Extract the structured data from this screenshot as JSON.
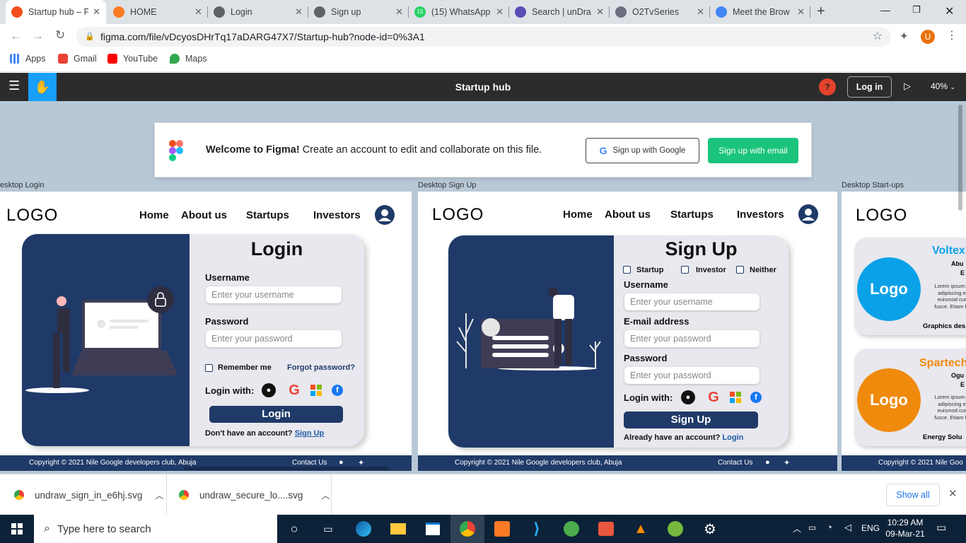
{
  "browser": {
    "tabs": [
      {
        "title": "Startup hub – F",
        "active": true,
        "color": "#f24e1e"
      },
      {
        "title": "HOME",
        "active": false,
        "color": "#fb7a24"
      },
      {
        "title": "Login",
        "active": false,
        "color": "#5f6368"
      },
      {
        "title": "Sign up",
        "active": false,
        "color": "#5f6368"
      },
      {
        "title": "(15) WhatsApp",
        "active": false,
        "color": "#25d366"
      },
      {
        "title": "Search | unDra",
        "active": false,
        "color": "#5a4bb5"
      },
      {
        "title": "O2TvSeries",
        "active": false,
        "color": "#6c6f7d"
      },
      {
        "title": "Meet the Brow",
        "active": false,
        "color": "#4285f4"
      }
    ],
    "whatsapp_badge": "15",
    "url": "figma.com/file/vDcyosDHrTq17aDARG47X7/Startup-hub?node-id=0%3A1",
    "profile_initial": "U",
    "bookmarks": [
      {
        "label": "Apps",
        "icon": "apps-grid-icon"
      },
      {
        "label": "Gmail",
        "icon": "gmail-icon"
      },
      {
        "label": "YouTube",
        "icon": "youtube-icon"
      },
      {
        "label": "Maps",
        "icon": "maps-icon"
      }
    ]
  },
  "figma": {
    "file_title": "Startup hub",
    "help_label": "?",
    "login_label": "Log in",
    "zoom": "40%",
    "banner": {
      "bold": "Welcome to Figma!",
      "text": " Create an account to edit and collaborate on this file.",
      "google_btn": "Sign up with Google",
      "email_btn": "Sign up with email"
    },
    "frame_labels": [
      "esktop Login",
      "Desktop Sign Up",
      "Desktop Start-ups"
    ]
  },
  "site": {
    "logo": "LOGO",
    "nav": [
      "Home",
      "About us",
      "Startups",
      "Investors"
    ],
    "footer_copyright": "Copyright  © 2021 Nile Google developers club, Abuja",
    "footer_copyright_short": "Copyright  © 2021 Nile Goo",
    "footer_contact": "Contact Us"
  },
  "login": {
    "title": "Login",
    "username_label": "Username",
    "username_placeholder": "Enter your username",
    "password_label": "Password",
    "password_placeholder": "Enter your password",
    "remember": "Remember me",
    "forgot": "Forgot password?",
    "login_with": "Login with:",
    "button": "Login",
    "no_account": "Don't have an account?",
    "signup_link": "Sign Up"
  },
  "signup": {
    "title": "Sign Up",
    "roles": [
      "Startup",
      "Investor",
      "Neither"
    ],
    "username_label": "Username",
    "username_placeholder": "Enter your username",
    "email_label": "E-mail address",
    "email_placeholder": "Enter your password",
    "password_label": "Password",
    "password_placeholder": "Enter your password",
    "login_with": "Login with:",
    "button": "Sign Up",
    "have_account": "Already have an account?",
    "login_link": "Login"
  },
  "startups": {
    "cards": [
      {
        "logo": "Logo",
        "name": "Voltex",
        "line1": "Abu",
        "line2": "E",
        "lorem": [
          "Lorem ipsum c",
          "adipiscing e",
          "euismod cur",
          "fusce. Etiam fe"
        ],
        "tag": "Graphics des",
        "color": "#0aa1e8"
      },
      {
        "logo": "Logo",
        "name": "Spartech",
        "line1": "Ogu",
        "line2": "E",
        "lorem": [
          "Lorem ipsum c",
          "adipiscing e",
          "euismod cur",
          "fusce. Etiam fe"
        ],
        "tag": "Energy Solu",
        "color": "#f08a0c"
      }
    ]
  },
  "downloads": {
    "items": [
      "undraw_sign_in_e6hj.svg",
      "undraw_secure_lo....svg"
    ],
    "show_all": "Show all"
  },
  "taskbar": {
    "search_placeholder": "Type here to search",
    "lang": "ENG",
    "time": "10:29 AM",
    "date": "09-Mar-21"
  }
}
